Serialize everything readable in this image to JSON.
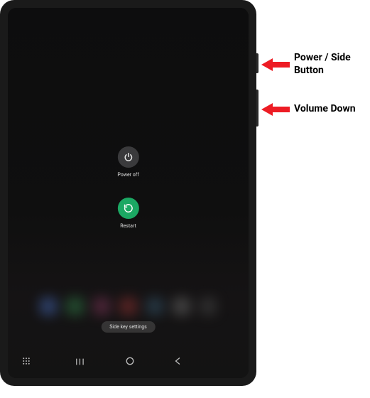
{
  "power_menu": {
    "power_off_label": "Power off",
    "restart_label": "Restart"
  },
  "side_key": {
    "label": "Side key settings"
  },
  "annotations": {
    "power_button": "Power / Side Button",
    "volume_down": "Volume Down"
  },
  "colors": {
    "arrow": "#ed1c24",
    "restart_bg": "#1ba863",
    "poweroff_bg": "#3a3a3c"
  }
}
